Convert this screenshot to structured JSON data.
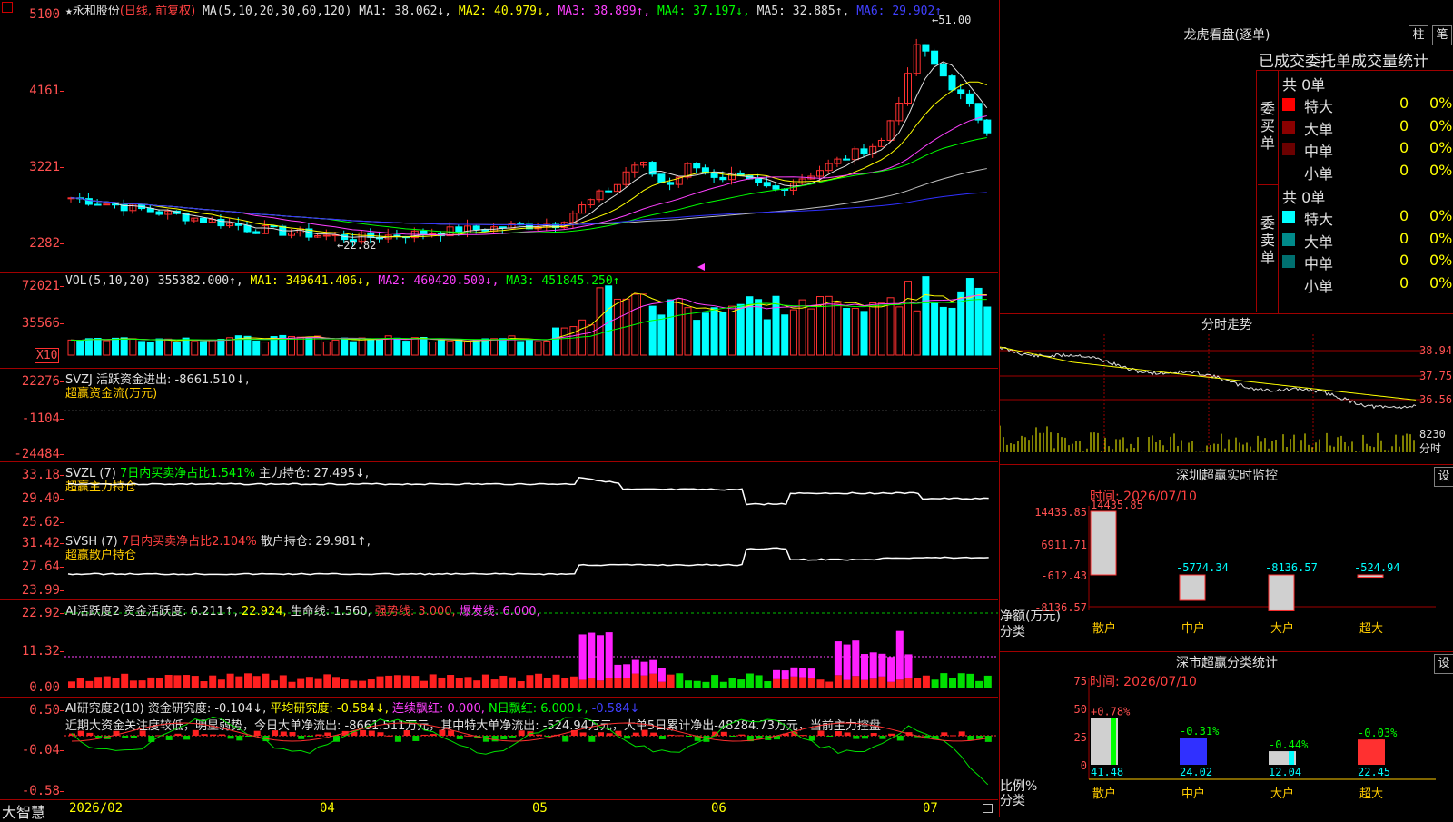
{
  "stock": {
    "name": "永和股份",
    "mode": "(日线, 前复权)",
    "star": "★"
  },
  "ma": {
    "label": "MA(5,10,20,30,60,120)",
    "ma1": "MA1: 38.062↓,",
    "ma2": "MA2: 40.979↓,",
    "ma3": "MA3: 38.899↑,",
    "ma4": "MA4: 37.197↓,",
    "ma5": "MA5: 32.885↑,",
    "ma6": "MA6: 29.902↑"
  },
  "price_axis": [
    "5100",
    "4161",
    "3221",
    "2282"
  ],
  "price_marks": {
    "high": "51.00",
    "low": "22.82"
  },
  "vol": {
    "label": "VOL(5,10,20)",
    "v": "355382.000↑,",
    "ma1": "MA1: 349641.406↓,",
    "ma2": "MA2: 460420.500↓,",
    "ma3": "MA3: 451845.250↑",
    "axis": [
      "72021",
      "35566"
    ],
    "unit": "X10"
  },
  "svzj": {
    "label": "SVZJ  活跃资金进出: -8661.510↓,",
    "sub": "超赢资金流(万元)",
    "axis": [
      "22276",
      "-1104",
      "-24484"
    ]
  },
  "svzl": {
    "label": "SVZL (7)",
    "ratio": "7日内买卖净占比1.541%",
    "hold": "主力持仓: 27.495↓,",
    "sub": "超赢主力持仓",
    "axis": [
      "33.18",
      "29.40",
      "25.62"
    ]
  },
  "svsh": {
    "label": "SVSH (7)",
    "ratio": "7日内买卖净占比2.104%",
    "hold": "散户持仓: 29.981↑,",
    "sub": "超赢散户持仓",
    "axis": [
      "31.42",
      "27.64",
      "23.99"
    ]
  },
  "ai1": {
    "label": "AI活跃度2 资金活跃度: 6.211↑,",
    "v2": "22.924,",
    "life": "生命线: 1.560,",
    "strong": "强势线: 3.000,",
    "burst": "爆发线: 6.000,",
    "axis": [
      "22.92",
      "11.32",
      "0.00"
    ]
  },
  "ai2": {
    "label": "AI研究度2(10) 资金研究度: -0.104↓,",
    "avg": "平均研究度: -0.584↓,",
    "red": "连续飘红: 0.000,",
    "n": "N日飘红: 6.000↓,",
    "last": "-0.584↓",
    "axis": [
      "0.50",
      "-0.04",
      "-0.58"
    ],
    "comment": "近期大资金关注度较低，明显弱势，今日大单净流出: -8661.511万元，其中特大单净流出: -524.94万元，大单5日累计净出-48284.73万元，当前主力控盘"
  },
  "dates": [
    "2026/02",
    "04",
    "05",
    "06",
    "07"
  ],
  "brand": "大智慧",
  "lhb": {
    "title": "龙虎看盘(逐单)",
    "btn1": "柱",
    "btn2": "笔",
    "tabs": "已成交委托单成交量统计",
    "buy_side": "委买单",
    "sell_side": "委卖单",
    "total_buy": "共 0单",
    "total_sell": "共 0单",
    "rows": [
      {
        "label": "特大",
        "v": "0",
        "p": "0%"
      },
      {
        "label": "大单",
        "v": "0",
        "p": "0%"
      },
      {
        "label": "中单",
        "v": "0",
        "p": "0%"
      },
      {
        "label": "小单",
        "v": "0",
        "p": "0%"
      }
    ],
    "buy_colors": [
      "#ff0000",
      "#8b0000",
      "#6b0000"
    ],
    "sell_colors": [
      "#00ffff",
      "#008b8b",
      "#007070"
    ]
  },
  "minute": {
    "title": "分时走势",
    "axis": [
      "38.94",
      "37.75",
      "36.56"
    ],
    "vol_axis": "8230",
    "vol_label": "分时"
  },
  "monitor": {
    "title": "深圳超赢实时监控",
    "settings": "设",
    "time": "时间: 2026/07/10",
    "axis": [
      "14435.85",
      "6911.71",
      "-612.43",
      "-8136.57"
    ],
    "ylabel": "净额(万元)",
    "xlabel": "分类",
    "bars": [
      {
        "cat": "散户",
        "value": "14435.85"
      },
      {
        "cat": "中户",
        "value": "-5774.34"
      },
      {
        "cat": "大户",
        "value": "-8136.57"
      },
      {
        "cat": "超大",
        "value": "-524.94"
      }
    ]
  },
  "classify": {
    "title": "深市超赢分类统计",
    "settings": "设",
    "time": "时间: 2026/07/10",
    "axis": [
      "75",
      "50",
      "25",
      "0"
    ],
    "ylabel": "比例%",
    "xlabel": "分类",
    "bars": [
      {
        "cat": "散户",
        "top": "+0.78%",
        "base": "41.48"
      },
      {
        "cat": "中户",
        "top": "-0.31%",
        "base": "24.02"
      },
      {
        "cat": "大户",
        "top": "-0.44%",
        "base": "12.04"
      },
      {
        "cat": "超大",
        "top": "-0.03%",
        "base": "22.45"
      }
    ]
  }
}
